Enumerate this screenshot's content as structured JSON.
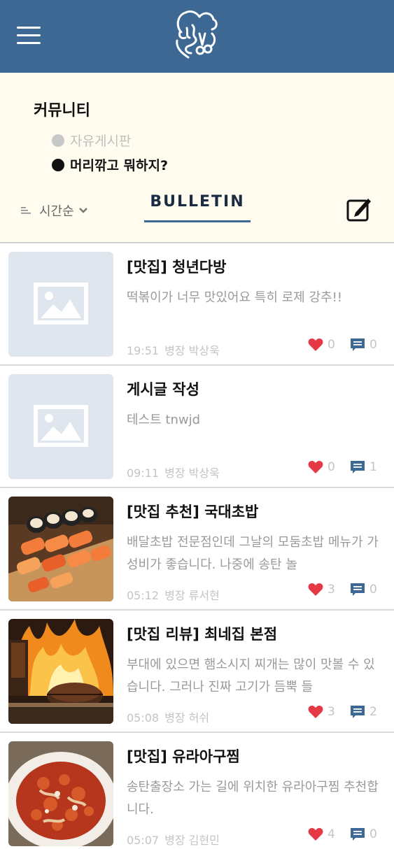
{
  "header": {
    "menu_icon": "hamburger-menu-icon",
    "logo_icon": "barber-logo-icon",
    "colors": {
      "bar": "#3c6893"
    }
  },
  "community": {
    "title": "커뮤니티",
    "boards": [
      {
        "label": "자유게시판",
        "active": false
      },
      {
        "label": "머리깎고 뭐하지?",
        "active": true
      }
    ]
  },
  "toolbar": {
    "sort_label": "시간순",
    "tab_label": "BULLETIN",
    "write_icon": "edit-icon"
  },
  "posts": [
    {
      "title": "[맛집] 청년다방",
      "body": "떡볶이가 너무 맛있어요 특히 로제 강추!!",
      "time": "19:51",
      "author": "병장 박상욱",
      "likes": "0",
      "comments": "0",
      "image": "placeholder-image"
    },
    {
      "title": "게시글 작성",
      "body": "테스트 tnwjd",
      "time": "09:11",
      "author": "병장 박상욱",
      "likes": "0",
      "comments": "1",
      "image": "placeholder-image"
    },
    {
      "title": "[맛집 추천] 국대초밥",
      "body": "배달초밥 전문점인데 그날의 모둠초밥 메뉴가 가성비가 좋습니다. 나중에 송탄 놀",
      "time": "05:12",
      "author": "병장 류서현",
      "likes": "3",
      "comments": "0",
      "image": "sushi-photo"
    },
    {
      "title": "[맛집 리뷰] 최네집 본점",
      "body": "부대에 있으면 햄소시지 찌개는 많이 맛볼 수 있습니다. 그러나 진짜 고기가 듬뿍 들",
      "time": "05:08",
      "author": "병장 허쉬",
      "likes": "3",
      "comments": "2",
      "image": "grilled-meat-photo"
    },
    {
      "title": "[맛집] 유라아구찜",
      "body": "송탄출장소 가는 길에 위치한 유라아구찜 추천합니다.",
      "time": "05:07",
      "author": "병장 김현민",
      "likes": "4",
      "comments": "0",
      "image": "braised-seafood-photo"
    }
  ]
}
